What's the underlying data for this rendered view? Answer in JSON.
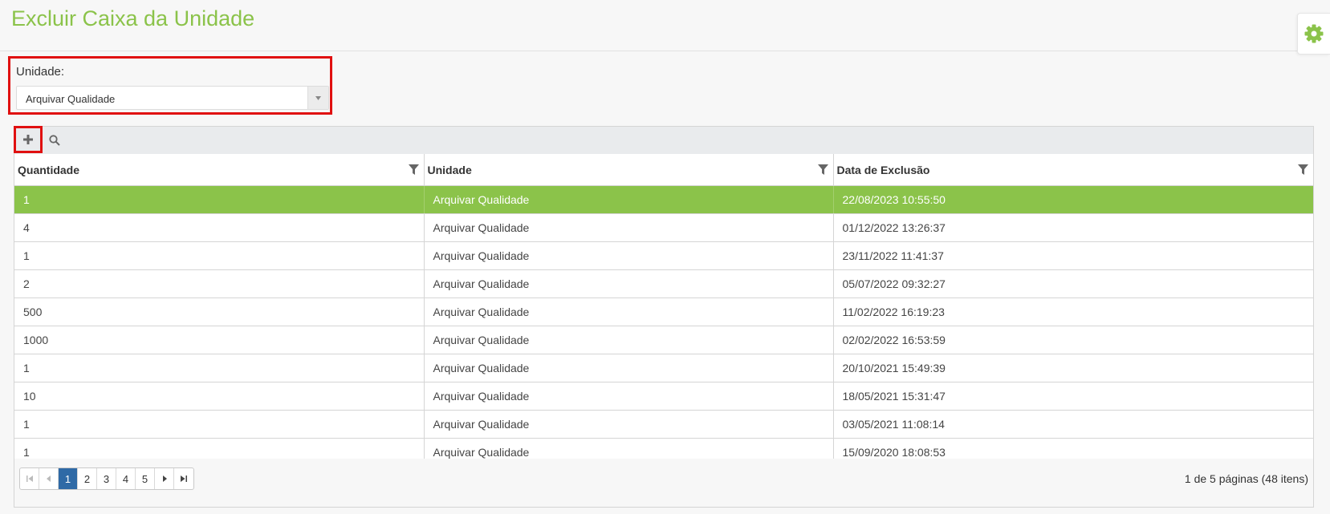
{
  "page": {
    "title": "Excluir Caixa da Unidade"
  },
  "settings": {
    "icon": "gear-icon",
    "color": "#8bc34a"
  },
  "filter": {
    "label": "Unidade:",
    "selected": "Arquivar Qualidade"
  },
  "toolbar": {
    "add_icon": "plus-icon",
    "search_icon": "search-icon"
  },
  "table": {
    "columns": [
      "Quantidade",
      "Unidade",
      "Data de Exclusão"
    ],
    "rows": [
      [
        "1",
        "Arquivar Qualidade",
        "22/08/2023 10:55:50"
      ],
      [
        "4",
        "Arquivar Qualidade",
        "01/12/2022 13:26:37"
      ],
      [
        "1",
        "Arquivar Qualidade",
        "23/11/2022 11:41:37"
      ],
      [
        "2",
        "Arquivar Qualidade",
        "05/07/2022 09:32:27"
      ],
      [
        "500",
        "Arquivar Qualidade",
        "11/02/2022 16:19:23"
      ],
      [
        "1000",
        "Arquivar Qualidade",
        "02/02/2022 16:53:59"
      ],
      [
        "1",
        "Arquivar Qualidade",
        "20/10/2021 15:49:39"
      ],
      [
        "10",
        "Arquivar Qualidade",
        "18/05/2021 15:31:47"
      ],
      [
        "1",
        "Arquivar Qualidade",
        "03/05/2021 11:08:14"
      ],
      [
        "1",
        "Arquivar Qualidade",
        "15/09/2020 18:08:53"
      ]
    ],
    "selected_row": 0
  },
  "pager": {
    "pages": [
      "1",
      "2",
      "3",
      "4",
      "5"
    ],
    "current": "1",
    "info": "1 de 5 páginas (48 itens)"
  },
  "colors": {
    "accent": "#8bc34a",
    "highlight_border": "#e01010",
    "pager_active": "#2f6aa6"
  }
}
